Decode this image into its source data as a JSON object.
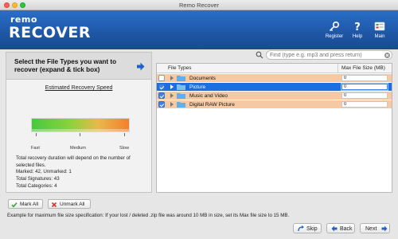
{
  "window": {
    "title": "Remo Recover"
  },
  "header": {
    "logo_top": "remo",
    "logo_bottom": "RECOVER",
    "buttons": [
      {
        "label": "Register",
        "icon": "key-icon"
      },
      {
        "label": "Help",
        "icon": "help-icon"
      },
      {
        "label": "Main",
        "icon": "main-menu-icon"
      }
    ]
  },
  "left_panel": {
    "title": "Select the File Types you want to recover (expand & tick box)",
    "estimated_speed_label": "Estimated Recovery Speed",
    "speed_labels": [
      "Fast",
      "Medium",
      "Slow"
    ],
    "duration_note": "Total recovery duration will depend on the number of selected files.",
    "marked_text": "Marked: 42, Unmarked: 1",
    "signatures_text": "Total Signatures: 43",
    "categories_text": "Total Categories: 4"
  },
  "search": {
    "placeholder": "Find (type e.g. mp3 and press return)",
    "value": ""
  },
  "tree": {
    "col_types": "File Types",
    "col_max": "Max File Size (MB)",
    "rows": [
      {
        "label": "Documents",
        "checked": false,
        "max_size": "0",
        "style": "orange"
      },
      {
        "label": "Picture",
        "checked": true,
        "max_size": "0",
        "style": "selected"
      },
      {
        "label": "Music and Video",
        "checked": true,
        "max_size": "0",
        "style": "orange"
      },
      {
        "label": "Digital RAW Picture",
        "checked": true,
        "max_size": "0",
        "style": "orange"
      }
    ]
  },
  "actions": {
    "mark_all": "Mark All",
    "unmark_all": "Unmark All"
  },
  "example_text": "Example for maximum file size specification: If your lost / deleted .zip file was around 10 MB in size, set its Max file size to 15 MB.",
  "nav": {
    "skip": "Skip",
    "back": "Back",
    "next": "Next"
  },
  "colors": {
    "header_blue": "#1f58a8",
    "row_orange": "#f5c9a3",
    "row_selected": "#1b6fe0",
    "checkbox_blue": "#3c84e8",
    "arrow_blue": "#1e64c8",
    "green": "#3aa33a",
    "red": "#d9322b"
  }
}
